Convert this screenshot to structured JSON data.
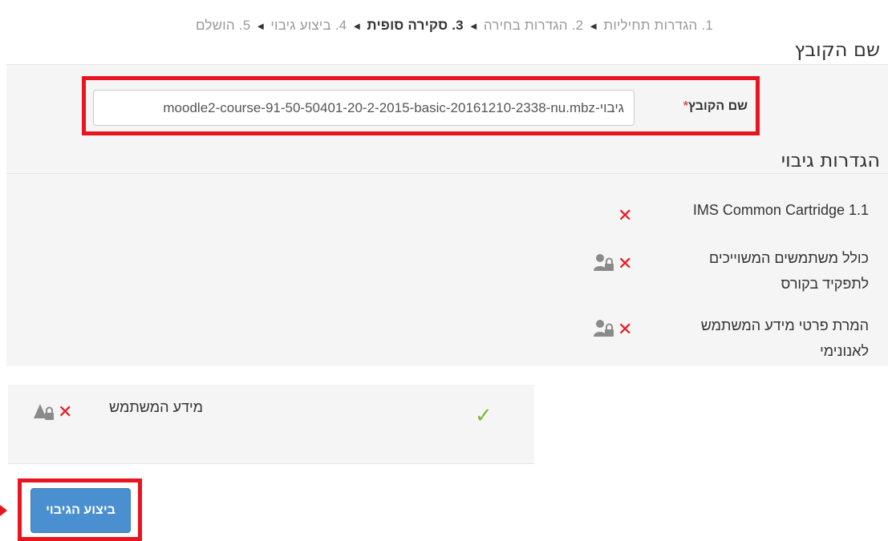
{
  "stepper": {
    "steps": [
      {
        "num": "1.",
        "label": "הגדרות תחיליות",
        "current": false
      },
      {
        "num": "2.",
        "label": "הגדרות בחירה",
        "current": false
      },
      {
        "num": "3.",
        "label": "סקירה סופית",
        "current": true
      },
      {
        "num": "4.",
        "label": "ביצוע גיבוי",
        "current": false
      },
      {
        "num": "5.",
        "label": "הושלם",
        "current": false
      }
    ],
    "separator": "◄"
  },
  "filename_section": {
    "legend": "שם הקובץ",
    "field_label": "שם הקובץ",
    "required_mark": "*",
    "value": "גיבוי-moodle2-course-91-50-50401-20-2-2015-basic-20161210-2338-nu.mbz"
  },
  "settings_section": {
    "legend": "הגדרות גיבוי",
    "items": [
      {
        "label": "IMS Common Cartridge 1.1",
        "state": "x-icon",
        "locked": false
      },
      {
        "label_line1": "כולל משתמשים המשוייכים",
        "label_line2": "לתפקיד בקורס",
        "state": "x-icon",
        "locked": true
      },
      {
        "label_line1": "המרת פרטי מידע המשתמש",
        "label_line2": "לאנונימי",
        "state": "x-icon",
        "locked": true
      }
    ],
    "bottom_item": {
      "label": "מידע המשתמש",
      "state": "x-icon",
      "locked": true,
      "check": "check-icon"
    }
  },
  "actions": {
    "backup_label": "ביצוע הגיבוי"
  },
  "colors": {
    "highlight": "#e8151f",
    "primary_button": "#4a8fcf",
    "check": "#7ab83a",
    "cross": "#e8151f"
  }
}
